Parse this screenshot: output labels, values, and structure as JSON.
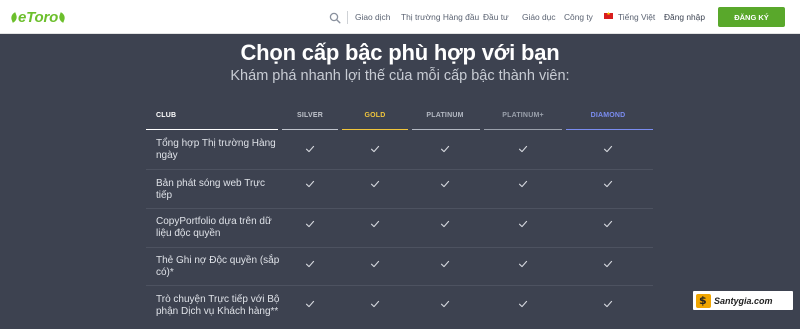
{
  "brand": {
    "logo_text": "eToro"
  },
  "nav": {
    "items": [
      "Giao dịch",
      "Thị trường Hàng đầu",
      "Đầu tư",
      "Giáo dục",
      "Công ty"
    ],
    "language": "Tiếng Việt",
    "login": "Đăng nhập",
    "signup": "ĐĂNG KÝ"
  },
  "hero": {
    "title": "Chọn cấp bậc phù hợp với bạn",
    "subtitle": "Khám phá nhanh lợi thế của mỗi cấp bậc thành viên:"
  },
  "table": {
    "club_label": "CLUB",
    "tiers": [
      {
        "name": "SILVER",
        "color": "#c0c4cc"
      },
      {
        "name": "GOLD",
        "color": "#f0c53c"
      },
      {
        "name": "PLATINUM",
        "color": "#b3b8c2"
      },
      {
        "name": "PLATINUM+",
        "color": "#9aa0ab"
      },
      {
        "name": "DIAMOND",
        "color": "#7a8cf0"
      }
    ],
    "rows": [
      {
        "label": "Tổng hợp Thị trường Hàng ngày",
        "checks": [
          true,
          true,
          true,
          true,
          true
        ]
      },
      {
        "label": "Bản phát sóng web Trực tiếp",
        "checks": [
          true,
          true,
          true,
          true,
          true
        ]
      },
      {
        "label": "CopyPortfolio dựa trên dữ liệu độc quyền",
        "checks": [
          true,
          true,
          true,
          true,
          true
        ]
      },
      {
        "label": "Thẻ Ghi nợ Độc quyền (sắp có)*",
        "checks": [
          true,
          true,
          true,
          true,
          true
        ]
      },
      {
        "label": "Trò chuyện Trực tiếp với Bộ phận Dịch vụ Khách hàng**",
        "checks": [
          true,
          true,
          true,
          true,
          true
        ]
      }
    ]
  },
  "watermark": {
    "text": "Santygia.com"
  },
  "colors": {
    "background": "#3d4250",
    "accent_green": "#59a82b",
    "checkmark": "#d4d7dd"
  },
  "icons": {
    "search": "search-icon",
    "flag": "vietnam-flag-icon",
    "check": "check-icon"
  }
}
